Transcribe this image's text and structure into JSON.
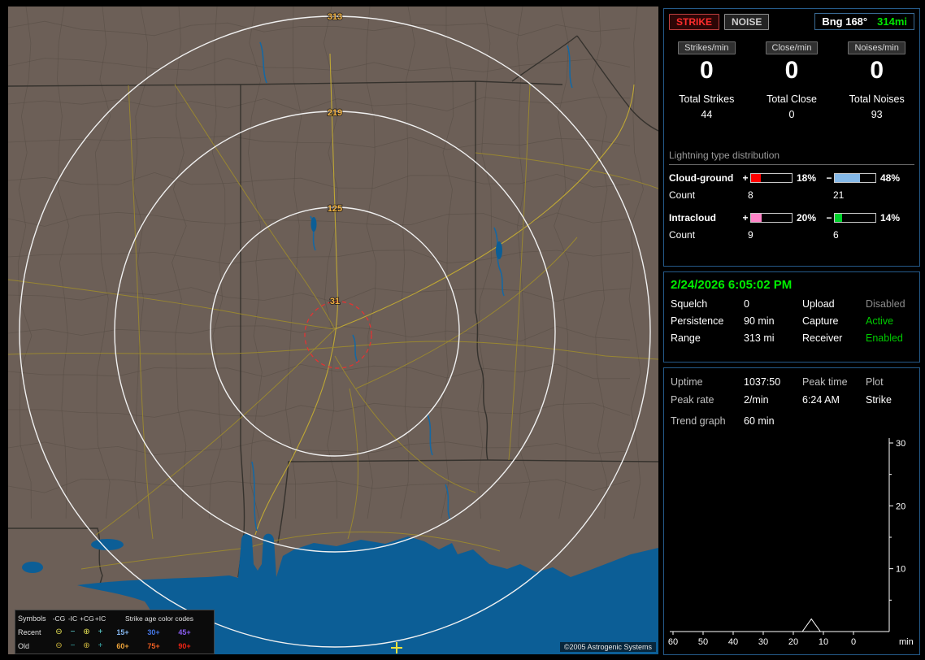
{
  "colors": {
    "accent_green": "#00e600",
    "range_label": "#f0b040",
    "bar_cg_plus": "#ff0000",
    "bar_cg_minus": "#85b9e8",
    "bar_ic_plus": "#ff85c8",
    "bar_ic_minus": "#00d22d"
  },
  "map": {
    "range_labels": {
      "outer": "313",
      "second": "219",
      "third": "125",
      "inner": "31"
    },
    "copyright": "©2005 Astrogenic Systems",
    "legend": {
      "symbols_title": "Symbols",
      "type_headers": [
        "-CG",
        "-IC",
        "+CG",
        "+IC"
      ],
      "age_title": "Strike age color codes",
      "symbol_glyphs": {
        "neg_cg": "⊖",
        "neg_ic": "−",
        "pos_cg": "⊕",
        "pos_ic": "+"
      },
      "symbol_colors": {
        "recent_cg": "#e8e455",
        "recent_ic": "#62d8d8",
        "old_cg": "#c9b23c",
        "old_ic": "#3aa8a8"
      },
      "rows": [
        {
          "label": "Recent",
          "ages": [
            {
              "text": "15+",
              "color": "#86b9f2"
            },
            {
              "text": "30+",
              "color": "#4678e8"
            },
            {
              "text": "45+",
              "color": "#8a5cf0"
            }
          ]
        },
        {
          "label": "Old",
          "ages": [
            {
              "text": "60+",
              "color": "#eda33a"
            },
            {
              "text": "75+",
              "color": "#ef5f22"
            },
            {
              "text": "90+",
              "color": "#f02314"
            }
          ]
        }
      ]
    }
  },
  "panel": {
    "mode_buttons": {
      "strike": "STRIKE",
      "noise": "NOISE"
    },
    "bearing": {
      "label": "Bng 168°",
      "range": "314mi"
    },
    "rates": [
      {
        "button": "Strikes/min",
        "value": "0",
        "total_label": "Total Strikes",
        "total_value": "44"
      },
      {
        "button": "Close/min",
        "value": "0",
        "total_label": "Total Close",
        "total_value": "0"
      },
      {
        "button": "Noises/min",
        "value": "0",
        "total_label": "Total Noises",
        "total_value": "93"
      }
    ],
    "distribution": {
      "title": "Lightning type distribution",
      "count_label": "Count",
      "rows": [
        {
          "label": "Cloud-ground",
          "plus_sign": "+",
          "plus_pct": 18,
          "plus_pct_text": "18%",
          "plus_count": "8",
          "minus_sign": "−",
          "minus_pct": 48,
          "minus_pct_text": "48%",
          "minus_count": "21"
        },
        {
          "label": "Intracloud",
          "plus_sign": "+",
          "plus_pct": 20,
          "plus_pct_text": "20%",
          "plus_count": "9",
          "minus_sign": "−",
          "minus_pct": 14,
          "minus_pct_text": "14%",
          "minus_count": "6"
        }
      ]
    },
    "status": {
      "datetime": "2/24/2026 6:05:02 PM",
      "rows": [
        {
          "label_a": "Squelch",
          "value_a": "0",
          "label_b": "Upload",
          "value_b": "Disabled",
          "b_state": "disabled"
        },
        {
          "label_a": "Persistence",
          "value_a": "90 min",
          "label_b": "Capture",
          "value_b": "Active",
          "b_state": "active"
        },
        {
          "label_a": "Range",
          "value_a": "313 mi",
          "label_b": "Receiver",
          "value_b": "Enabled",
          "b_state": "active"
        }
      ]
    },
    "session": {
      "uptime_label": "Uptime",
      "uptime_value": "1037:50",
      "peak_time_label": "Peak time",
      "plot_label": "Plot",
      "peak_rate_label": "Peak rate",
      "peak_rate_value": "2/min",
      "peak_time_value": "6:24 AM",
      "plot_value": "Strike",
      "trend_label": "Trend graph",
      "trend_value": "60 min"
    }
  },
  "chart_data": {
    "type": "line",
    "title": "Strike trend, last 60 minutes",
    "xlabel": "min",
    "ylabel": "",
    "x_ticks": [
      60,
      50,
      40,
      30,
      20,
      10,
      0
    ],
    "y_ticks": [
      10,
      20,
      30
    ],
    "ylim": [
      0,
      30
    ],
    "xlim": [
      60,
      0
    ],
    "grid": false,
    "legend_position": "none",
    "series": [
      {
        "name": "Strike",
        "points": [
          [
            60,
            0
          ],
          [
            17,
            0
          ],
          [
            14,
            2
          ],
          [
            11,
            0
          ],
          [
            0,
            0
          ]
        ]
      }
    ]
  }
}
